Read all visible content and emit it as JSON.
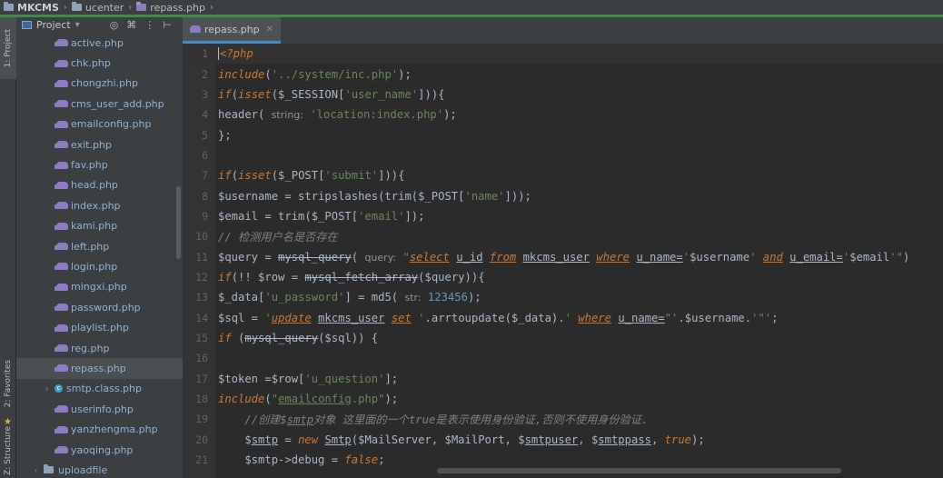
{
  "breadcrumb": {
    "root": "MKCMS",
    "folder": "ucenter",
    "file": "repass.php"
  },
  "side_tabs": {
    "project": "1: Project",
    "favorites": "2: Favorites",
    "structure": "Z: Structure"
  },
  "project_panel": {
    "title": "Project",
    "files": [
      "active.php",
      "chk.php",
      "chongzhi.php",
      "cms_user_add.php",
      "emailconfig.php",
      "exit.php",
      "fav.php",
      "head.php",
      "index.php",
      "kami.php",
      "left.php",
      "login.php",
      "mingxi.php",
      "password.php",
      "playlist.php",
      "reg.php",
      "repass.php",
      "smtp.class.php",
      "userinfo.php",
      "yanzhengma.php",
      "yaoqing.php"
    ],
    "selected_file": "repass.php",
    "class_file": "smtp.class.php",
    "last_folder": "uploadfile"
  },
  "editor": {
    "tab_label": "repass.php",
    "line_numbers": [
      "1",
      "2",
      "3",
      "4",
      "5",
      "6",
      "7",
      "8",
      "9",
      "10",
      "11",
      "12",
      "13",
      "14",
      "15",
      "16",
      "17",
      "18",
      "19",
      "20",
      "21"
    ]
  },
  "colors": {
    "background": "#2b2b2b",
    "panel": "#3c3f41",
    "keyword": "#cc7832",
    "string": "#6a8759",
    "number": "#6897bb",
    "function": "#ffc66d",
    "comment": "#808080",
    "accent_green": "#3f8c43"
  },
  "icons": [
    "folder-icon",
    "php-elephant-icon",
    "class-icon",
    "gear-icon",
    "collapse-icon",
    "star-icon"
  ]
}
